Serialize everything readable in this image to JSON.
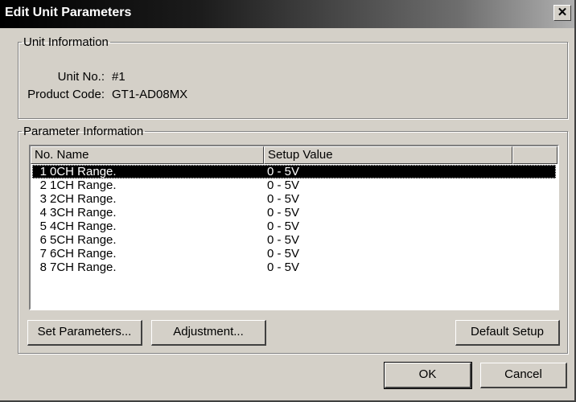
{
  "window": {
    "title": "Edit Unit Parameters",
    "close_glyph": "✕"
  },
  "unit_info": {
    "legend": "Unit Information",
    "unit_no_label": "Unit No.:",
    "unit_no_value": "#1",
    "product_code_label": "Product Code:",
    "product_code_value": "GT1-AD08MX"
  },
  "param_info": {
    "legend": "Parameter Information",
    "columns": [
      "No. Name",
      "Setup Value",
      ""
    ],
    "rows": [
      {
        "no": "1",
        "name": "0CH Range.",
        "value": "0 - 5V"
      },
      {
        "no": "2",
        "name": "1CH Range.",
        "value": "0 - 5V"
      },
      {
        "no": "3",
        "name": "2CH Range.",
        "value": "0 - 5V"
      },
      {
        "no": "4",
        "name": "3CH Range.",
        "value": "0 - 5V"
      },
      {
        "no": "5",
        "name": "4CH Range.",
        "value": "0 - 5V"
      },
      {
        "no": "6",
        "name": "5CH Range.",
        "value": "0 - 5V"
      },
      {
        "no": "7",
        "name": "6CH Range.",
        "value": "0 - 5V"
      },
      {
        "no": "8",
        "name": "7CH Range.",
        "value": "0 - 5V"
      }
    ],
    "selected_row": 0
  },
  "buttons": {
    "set_parameters": "Set Parameters...",
    "adjustment": "Adjustment...",
    "default_setup": "Default Setup",
    "ok": "OK",
    "cancel": "Cancel"
  }
}
